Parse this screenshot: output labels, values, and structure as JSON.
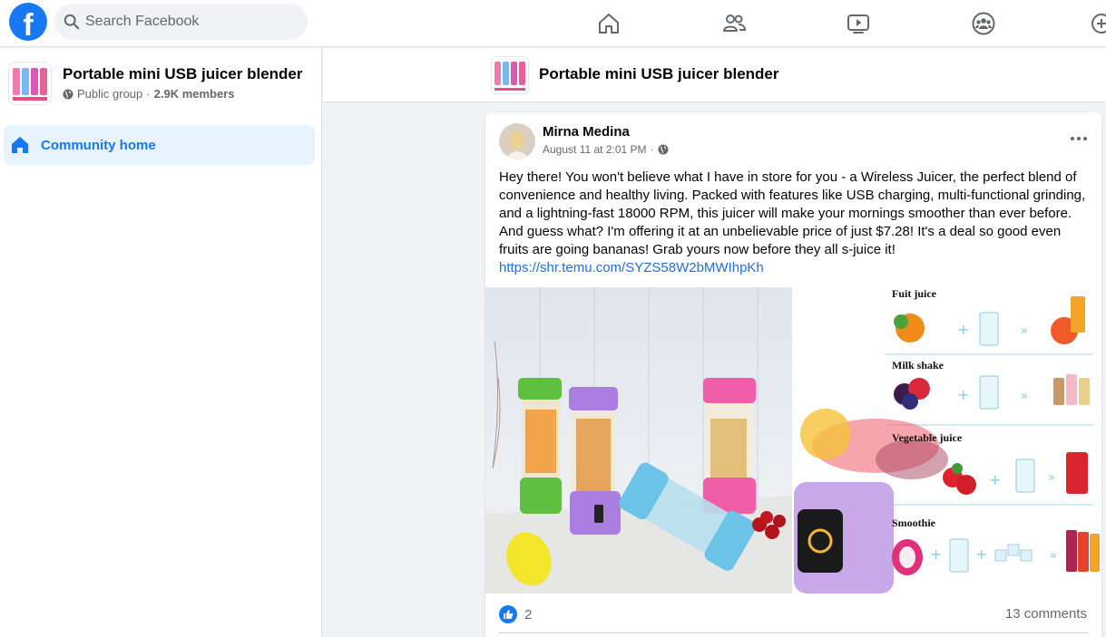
{
  "topbar": {
    "logo_letter": "f",
    "search_placeholder": "Search Facebook",
    "nav": [
      "home-icon",
      "friends-icon",
      "watch-icon",
      "groups-icon",
      "create-icon"
    ]
  },
  "sidebar": {
    "group_name": "Portable mini USB juicer blender",
    "privacy": "Public group",
    "separator": "·",
    "members": "2.9K members",
    "community_home": "Community home"
  },
  "group_header": {
    "title": "Portable mini USB juicer blender"
  },
  "post": {
    "author": "Mirna Medina",
    "timestamp": "August 11 at 2:01 PM",
    "separator": "·",
    "privacy_icon": "globe-icon",
    "text": "Hey there! You won't believe what I have in store for you - a Wireless Juicer, the perfect blend of convenience and healthy living. Packed with features like USB charging, multi-functional grinding, and a lightning-fast 18000 RPM, this juicer will make your mornings smoother than ever before. And guess what? I'm offering it at an unbelievable price of just $7.28! It's a deal so good even fruits are going bananas! Grab yours now before they all s-juice it!",
    "link": "https://shr.temu.com/SYZS58W2bMWIhpKh",
    "infographic": {
      "rows": [
        "Fuit juice",
        "Milk shake",
        "Vegetable juice",
        "Smoothie"
      ]
    },
    "reactions_count": "2",
    "comments_count": "13 comments"
  },
  "colors": {
    "brand": "#1877f2",
    "link": "#216fdb",
    "selected_bg": "#e7f3ff",
    "page_bg": "#f0f2f5"
  }
}
